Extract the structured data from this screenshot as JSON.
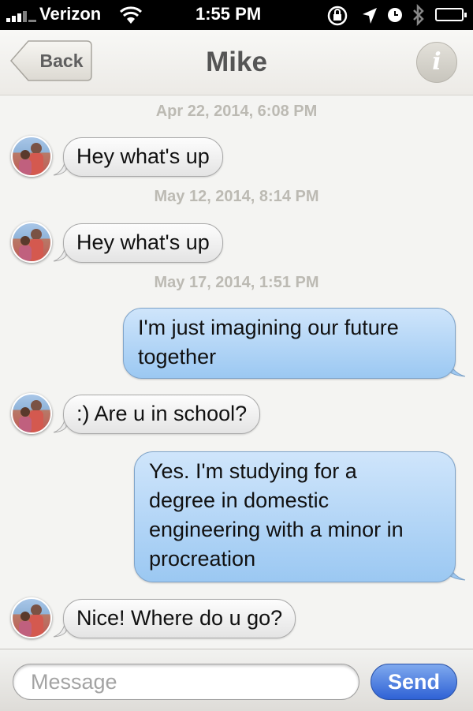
{
  "status_bar": {
    "carrier": "Verizon",
    "time": "1:55 PM",
    "icons": [
      "signal-icon",
      "wifi-icon",
      "rotation-lock-icon",
      "location-icon",
      "alarm-icon",
      "bluetooth-icon",
      "battery-icon"
    ]
  },
  "nav": {
    "back_label": "Back",
    "title": "Mike",
    "info_label": "i"
  },
  "messages": [
    {
      "type": "timestamp",
      "text": "Apr 22, 2014, 6:08 PM"
    },
    {
      "type": "incoming",
      "text": "Hey what's up"
    },
    {
      "type": "timestamp",
      "text": "May 12, 2014, 8:14 PM"
    },
    {
      "type": "incoming",
      "text": "Hey what's up"
    },
    {
      "type": "timestamp",
      "text": "May 17, 2014, 1:51 PM"
    },
    {
      "type": "outgoing",
      "lines": [
        "I'm just imagining our future",
        "together"
      ]
    },
    {
      "type": "incoming",
      "text": ":) Are u in school?"
    },
    {
      "type": "outgoing",
      "lines": [
        "Yes. I'm studying for a",
        "degree in domestic",
        "engineering with a minor in",
        "procreation"
      ]
    },
    {
      "type": "incoming",
      "text": "Nice! Where do u go?"
    }
  ],
  "composer": {
    "placeholder": "Message",
    "value": "",
    "send_label": "Send"
  },
  "colors": {
    "outgoing_bubble": "#a8cff5",
    "incoming_bubble": "#f0f0f0",
    "send_button": "#3a6fdc",
    "timestamp_text": "#bcbab3"
  }
}
